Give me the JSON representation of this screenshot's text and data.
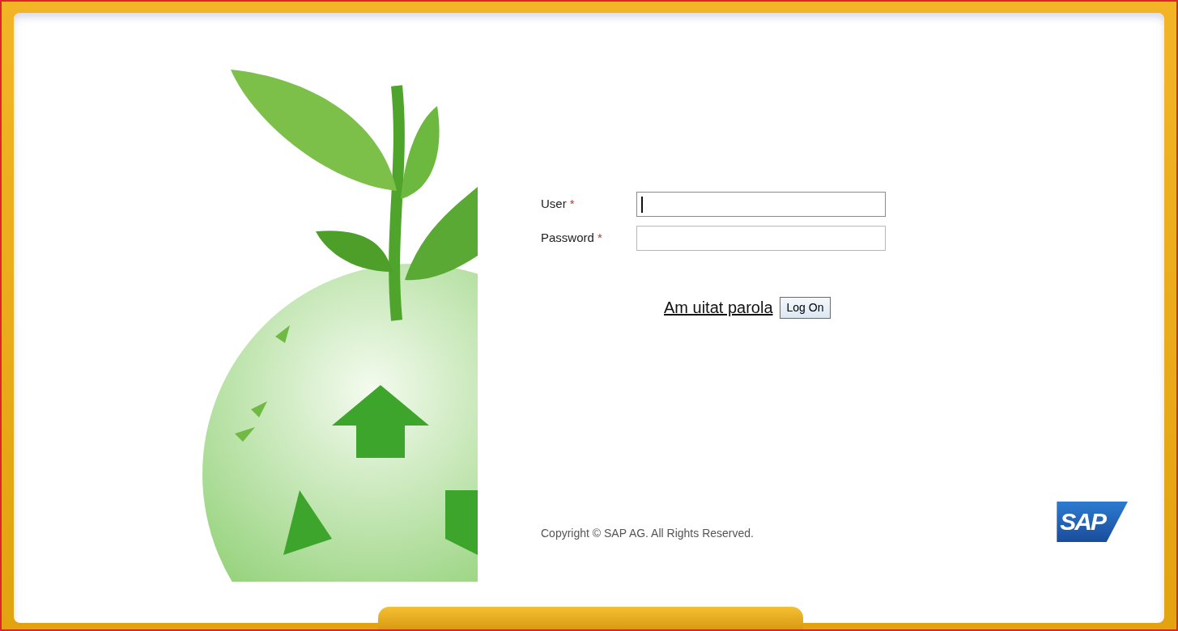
{
  "form": {
    "fields": [
      {
        "label": "User",
        "marker": "*",
        "focused": true
      },
      {
        "label": "Password",
        "marker": "*",
        "focused": false
      }
    ],
    "forgot_link": "Am uitat parola",
    "submit": "Log On"
  },
  "footer": {
    "copyright": "Copyright © SAP AG. All Rights Reserved.",
    "logo": "SAP"
  }
}
